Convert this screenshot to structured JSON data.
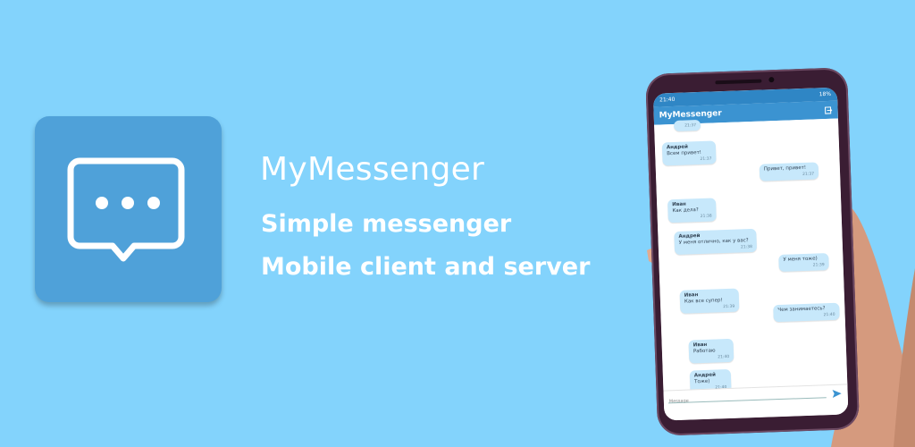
{
  "app": {
    "name": "MyMessenger",
    "tagline_1": "Simple messenger",
    "tagline_2": "Mobile client and server"
  },
  "colors": {
    "background": "#83d3fc",
    "icon_tile": "#4fa1d9",
    "phone_primary": "#3b93d1",
    "bubble": "#c7e8fb"
  },
  "phone": {
    "status": {
      "time": "21:40",
      "battery": "18%"
    },
    "appbar_title": "MyMessenger",
    "messages": [
      {
        "author": "",
        "text": "",
        "time": "21:37"
      },
      {
        "author": "Андрей",
        "text": "Всем привет!",
        "time": "21:37"
      },
      {
        "author": "",
        "text": "Привет, привет!",
        "time": "21:37"
      },
      {
        "author": "Иван",
        "text": "Как дела?",
        "time": "21:38"
      },
      {
        "author": "Андрей",
        "text": "У меня отлично, как у вас?",
        "time": "21:38"
      },
      {
        "author": "",
        "text": "У меня тоже)",
        "time": "21:39"
      },
      {
        "author": "Иван",
        "text": "Как все супер!",
        "time": "21:39"
      },
      {
        "author": "",
        "text": "Чем занимаетесь?",
        "time": "21:40"
      },
      {
        "author": "Иван",
        "text": "Работаю",
        "time": "21:40"
      },
      {
        "author": "Андрей",
        "text": "Тоже)",
        "time": "21:40"
      }
    ],
    "input_placeholder": "Message"
  },
  "icons": {
    "app_icon": "chat-bubble-ellipsis-icon",
    "send": "send-icon",
    "logout": "logout-icon"
  }
}
